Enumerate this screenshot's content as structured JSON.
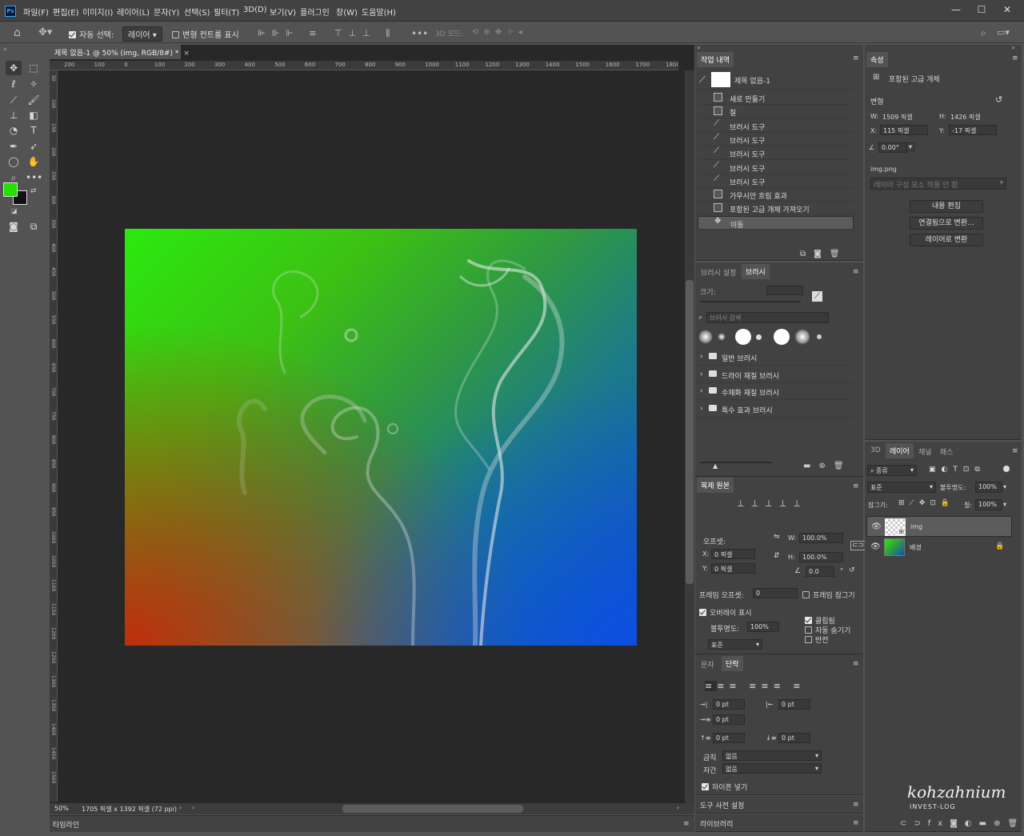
{
  "menubar": {
    "logo": "Ps",
    "items": [
      "파일(F)",
      "편집(E)",
      "이미지(I)",
      "레이어(L)",
      "문자(Y)",
      "선택(S)",
      "필터(T)",
      "3D(D)",
      "보기(V)",
      "플러그인",
      "창(W)",
      "도움말(H)"
    ]
  },
  "options": {
    "auto_select_label": "자동 선택:",
    "auto_select_value": "레이어",
    "transform_label": "변형 컨트롤 표시",
    "mode_3d": "3D 모드:",
    "share": "공유"
  },
  "document": {
    "tab_title": "제목 없음-1 @ 50% (img, RGB/8#) *",
    "ruler_top": [
      "200",
      "100",
      "0",
      "100",
      "200",
      "300",
      "400",
      "500",
      "600",
      "700",
      "800",
      "900",
      "1000",
      "1100",
      "1200",
      "1300",
      "1400",
      "1500",
      "1600",
      "1700",
      "1800"
    ],
    "ruler_left": [
      "50",
      "100",
      "150",
      "200",
      "250",
      "300",
      "350",
      "400",
      "450",
      "500",
      "550",
      "600",
      "650",
      "700",
      "750",
      "800",
      "850",
      "900",
      "950",
      "1000",
      "1050",
      "1100",
      "1150",
      "1200",
      "1250",
      "1300",
      "1350",
      "1400",
      "1450",
      "1500"
    ],
    "zoom": "50%",
    "size_info": "1705 픽셀 x 1392 픽셀 (72 ppi)"
  },
  "timeline": {
    "label": "타임라인"
  },
  "history": {
    "tab": "작업 내역",
    "snapshot": "제목 없음-1",
    "items": [
      {
        "label": "새로 만들기",
        "icon": "doc"
      },
      {
        "label": "칠",
        "icon": "doc"
      },
      {
        "label": "브러시 도구",
        "icon": "brush"
      },
      {
        "label": "브러시 도구",
        "icon": "brush"
      },
      {
        "label": "브러시 도구",
        "icon": "brush"
      },
      {
        "label": "브러시 도구",
        "icon": "brush"
      },
      {
        "label": "브러시 도구",
        "icon": "brush"
      },
      {
        "label": "가우시안 흐림 효과",
        "icon": "doc"
      },
      {
        "label": "포함된 고급 개체 가져오기",
        "icon": "doc"
      },
      {
        "label": "이동",
        "icon": "move"
      }
    ]
  },
  "brush": {
    "tabs": [
      "브러시 설정",
      "브러시"
    ],
    "size_label": "크기:",
    "search_placeholder": "브러시 검색",
    "folders": [
      "일반 브러시",
      "드라이 재질 브러시",
      "수채화 재질 브러시",
      "특수 효과 브러시"
    ]
  },
  "clone": {
    "tab": "복제 원본",
    "offset_label": "오프셋:",
    "x_label": "X:",
    "x_value": "0 픽셀",
    "y_label": "Y:",
    "y_value": "0 픽셀",
    "w_label": "W:",
    "w_value": "100.0%",
    "h_label": "H:",
    "h_value": "100.0%",
    "angle_value": "0.0",
    "angle_unit": "°",
    "frame_offset_label": "프레임 오프셋:",
    "frame_offset_value": "0",
    "frame_lock": "프레임 잠그기",
    "overlay": "오버레이 표시",
    "opacity_label": "불투명도:",
    "opacity_value": "100%",
    "clipped": "클립됨",
    "auto_hide": "자동 숨기기",
    "invert": "반전",
    "blend": "표준"
  },
  "paragraph": {
    "tabs": [
      "문자",
      "단락"
    ],
    "indent_values": [
      "0 pt",
      "0 pt",
      "0 pt",
      "0 pt",
      "0 pt"
    ],
    "kinsoku_label": "금칙",
    "kinsoku_value": "없음",
    "mojikumi_label": "자간",
    "mojikumi_value": "없음",
    "hyphenate": "하이픈 넣기"
  },
  "tool_presets": {
    "label": "도구 사전 설정"
  },
  "library": {
    "label": "라이브러리"
  },
  "properties": {
    "tab": "속성",
    "type": "포함된 고급 개체",
    "transform_label": "변형",
    "w_label": "W:",
    "w_value": "1509 픽셀",
    "h_label": "H:",
    "h_value": "1426 픽셀",
    "x_label": "X:",
    "x_value": "115 픽셀",
    "y_label": "Y:",
    "y_value": "-17 픽셀",
    "angle_value": "0.00°",
    "file": "img.png",
    "comp_placeholder": "레이어 구성 요소 적용 안 함",
    "btn_edit": "내용 편집",
    "btn_convert_linked": "연결됨으로 변환...",
    "btn_convert_layers": "레이어로 변환"
  },
  "layers": {
    "tabs": [
      "3D",
      "레이어",
      "채널",
      "패스"
    ],
    "filter_kind": "종류",
    "blend_mode": "표준",
    "opacity_label": "불투명도:",
    "opacity_value": "100%",
    "lock_label": "잠그기:",
    "fill_label": "칠:",
    "fill_value": "100%",
    "items": [
      {
        "name": "img",
        "selected": true
      },
      {
        "name": "배경",
        "selected": false
      }
    ]
  },
  "watermark": {
    "line1": "kohzahnium",
    "line2": "INVEST-LOG"
  },
  "colors": {
    "foreground": "#22e000",
    "background": "#111111",
    "accent": "#1473e6"
  }
}
